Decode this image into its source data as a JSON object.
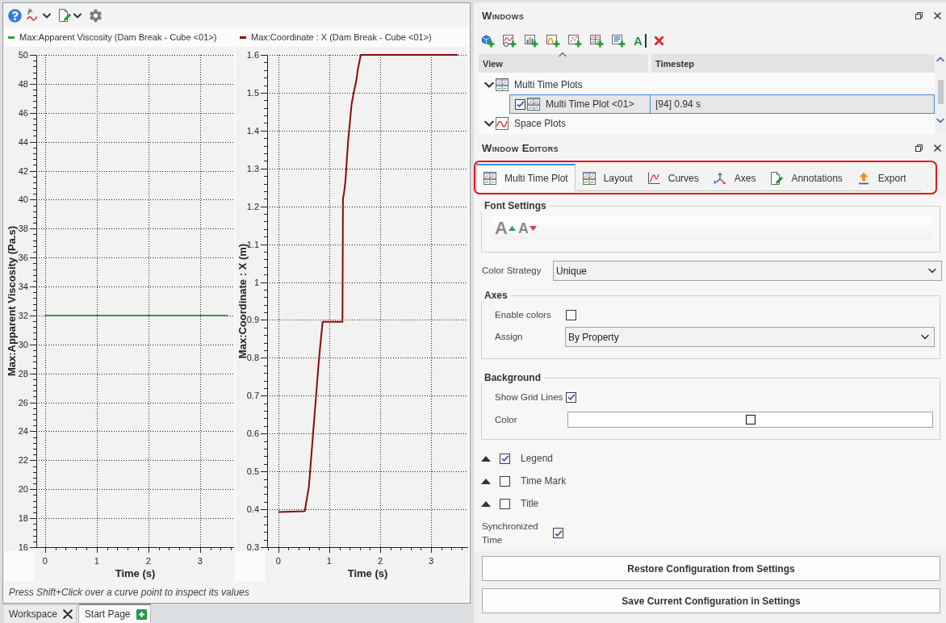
{
  "plot_panel": {
    "charts": [
      {
        "chart_data": {
          "type": "line",
          "xlabel": "Time (s)",
          "ylabel": "Max:Apparent Viscosity (Pa.s)",
          "x": [
            0,
            3.53
          ],
          "series": [
            {
              "name": "Max:Apparent Viscosity (Dam Break - Cube <01>)",
              "color": "#2f9e35",
              "values": [
                32,
                32
              ]
            }
          ],
          "xlim": [
            -0.17,
            3.66
          ],
          "ylim": [
            16,
            50
          ],
          "xticks": [
            0,
            1,
            2,
            3
          ],
          "yticks": [
            16,
            18,
            20,
            22,
            24,
            26,
            28,
            30,
            32,
            34,
            36,
            38,
            40,
            42,
            44,
            46,
            48,
            50
          ],
          "grid": true
        }
      },
      {
        "chart_data": {
          "type": "line",
          "xlabel": "Time (s)",
          "ylabel": "Max:Coordinate : X (m)",
          "x": [
            0,
            0.52,
            0.6,
            0.7,
            0.8,
            0.87,
            1.26,
            1.27,
            1.29,
            1.32,
            1.37,
            1.44,
            1.48,
            1.53,
            1.56,
            1.62,
            3.53
          ],
          "series": [
            {
              "name": "Max:Coordinate : X (Dam Break - Cube <01>)",
              "color": "#8a0c0c",
              "values": [
                0.393,
                0.395,
                0.46,
                0.63,
                0.8,
                0.895,
                0.895,
                1.22,
                1.235,
                1.27,
                1.37,
                1.47,
                1.5,
                1.53,
                1.56,
                1.6,
                1.6
              ]
            }
          ],
          "xlim": [
            -0.22,
            3.73
          ],
          "ylim": [
            0.3,
            1.6
          ],
          "xticks": [
            0,
            1,
            2,
            3
          ],
          "yticks": [
            0.3,
            0.4,
            0.5,
            0.6,
            0.7,
            0.8,
            0.9,
            1,
            1.1,
            1.2,
            1.3,
            1.4,
            1.5,
            1.6
          ],
          "grid": true
        }
      }
    ],
    "hint": "Press Shift+Click over a curve point to inspect its values"
  },
  "document_tabs": [
    {
      "label": "Workspace",
      "kind": "closable",
      "selected": false
    },
    {
      "label": "Start Page",
      "kind": "addable",
      "selected": true
    }
  ],
  "windows": {
    "title": "Windows",
    "toolbar_text_button": "A",
    "tree": {
      "columns": [
        "View",
        "Timestep"
      ],
      "rows": [
        {
          "label": "Multi Time Plots",
          "expanded": true,
          "selected": false,
          "children": [
            {
              "label": "Multi Time Plot <01>",
              "timestep": "[94] 0.94 s",
              "checked": true,
              "selected": true
            }
          ]
        },
        {
          "label": "Space Plots",
          "expanded": true,
          "selected": false
        }
      ]
    }
  },
  "window_editors": {
    "title": "Window Editors",
    "tabs": [
      {
        "label": "Multi Time Plot",
        "selected": true
      },
      {
        "label": "Layout",
        "selected": false
      },
      {
        "label": "Curves",
        "selected": false
      },
      {
        "label": "Axes",
        "selected": false
      },
      {
        "label": "Annotations",
        "selected": false
      },
      {
        "label": "Export",
        "selected": false
      }
    ],
    "font_settings": {
      "title": "Font Settings",
      "buttons": [
        {
          "glyph": "A",
          "kind": "increase"
        },
        {
          "glyph": "A",
          "kind": "decrease"
        }
      ]
    },
    "color_strategy": {
      "label": "Color Strategy",
      "value": "Unique"
    },
    "axes": {
      "title": "Axes",
      "enable_colors": {
        "label": "Enable colors",
        "checked": false
      },
      "assign": {
        "label": "Assign",
        "value": "By Property"
      }
    },
    "background": {
      "title": "Background",
      "show_grid_lines": {
        "label": "Show Grid Lines",
        "checked": true
      },
      "color": {
        "label": "Color"
      }
    },
    "sections": [
      {
        "label": "Legend",
        "checked": true
      },
      {
        "label": "Time Mark",
        "checked": false
      },
      {
        "label": "Title",
        "checked": false
      }
    ],
    "synchronized_time": {
      "label": "Synchronized Time",
      "checked": true
    },
    "buttons": [
      "Restore Configuration from Settings",
      "Save Current Configuration in Settings"
    ]
  }
}
